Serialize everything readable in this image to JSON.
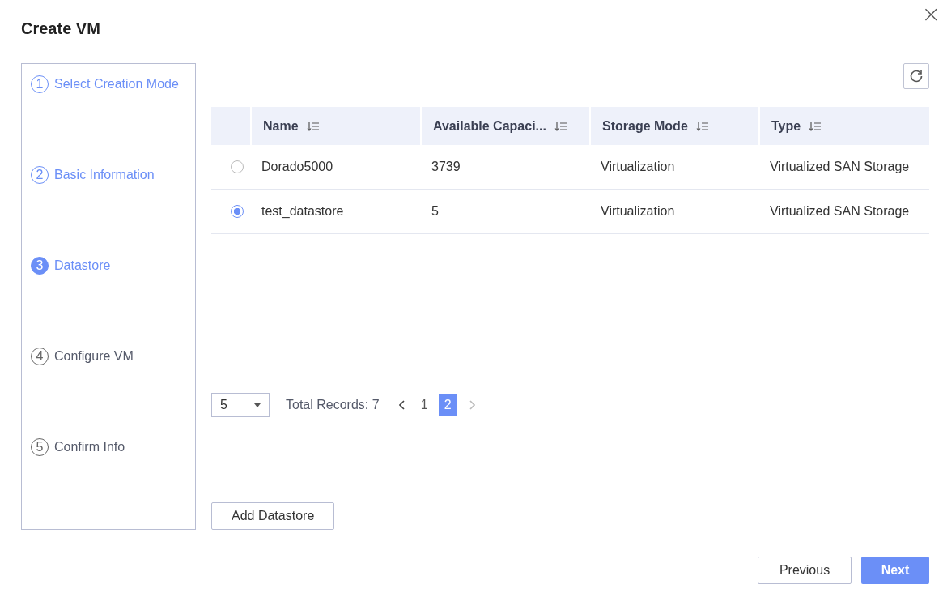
{
  "window": {
    "title": "Create VM",
    "close": "×"
  },
  "steps": [
    {
      "number": "1",
      "label": "Select Creation Mode",
      "done": true,
      "current": false
    },
    {
      "number": "2",
      "label": "Basic Information",
      "done": true,
      "current": false
    },
    {
      "number": "3",
      "label": "Datastore",
      "done": false,
      "current": true
    },
    {
      "number": "4",
      "label": "Configure VM",
      "done": false,
      "current": false
    },
    {
      "number": "5",
      "label": "Confirm Info",
      "done": false,
      "current": false
    }
  ],
  "table": {
    "columns": [
      "Name",
      "Available Capaci...",
      "Storage Mode",
      "Type"
    ],
    "rows": [
      {
        "selected": false,
        "cells": [
          "Dorado5000",
          "3739",
          "Virtualization",
          "Virtualized SAN Storage"
        ]
      },
      {
        "selected": true,
        "cells": [
          "test_datastore",
          "5",
          "Virtualization",
          "Virtualized SAN Storage"
        ]
      }
    ]
  },
  "pagination": {
    "page_size": "5",
    "total": "Total Records: 7",
    "pages": [
      {
        "label": "1",
        "selected": false
      },
      {
        "label": "2",
        "selected": true
      }
    ]
  },
  "add_button": "Add Datastore",
  "footer": {
    "previous": "Previous",
    "next": "Next"
  }
}
